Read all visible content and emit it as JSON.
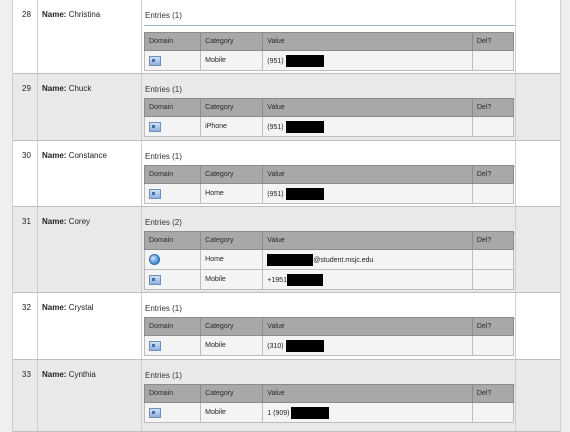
{
  "headers": {
    "domain": "Domain",
    "category": "Category",
    "value": "Value",
    "del": "Del?"
  },
  "name_prefix": "Name:",
  "contacts": [
    {
      "num": "28",
      "name": "Christina",
      "entries_label": "Entries (1)",
      "rows": [
        {
          "icon": "card-icon",
          "category": "Mobile",
          "value": "(951) "
        }
      ]
    },
    {
      "num": "29",
      "name": "Chuck",
      "entries_label": "Entries (1)",
      "rows": [
        {
          "icon": "card-icon",
          "category": "iPhone",
          "value": "(951) "
        }
      ]
    },
    {
      "num": "30",
      "name": "Constance",
      "entries_label": "Entries (1)",
      "rows": [
        {
          "icon": "card-icon",
          "category": "Home",
          "value": "(951) "
        }
      ]
    },
    {
      "num": "31",
      "name": "Corey",
      "entries_label": "Entries (2)",
      "rows": [
        {
          "icon": "globe-icon",
          "category": "Home",
          "value": "@student.msjc.edu"
        },
        {
          "icon": "card-icon",
          "category": "Mobile",
          "value": "+1951"
        }
      ]
    },
    {
      "num": "32",
      "name": "Crystal",
      "entries_label": "Entries (1)",
      "rows": [
        {
          "icon": "card-icon",
          "category": "Mobile",
          "value": "(310) "
        }
      ]
    },
    {
      "num": "33",
      "name": "Cynthia",
      "entries_label": "Entries (1)",
      "rows": [
        {
          "icon": "card-icon",
          "category": "Mobile",
          "value": "1 (909) "
        }
      ]
    }
  ]
}
